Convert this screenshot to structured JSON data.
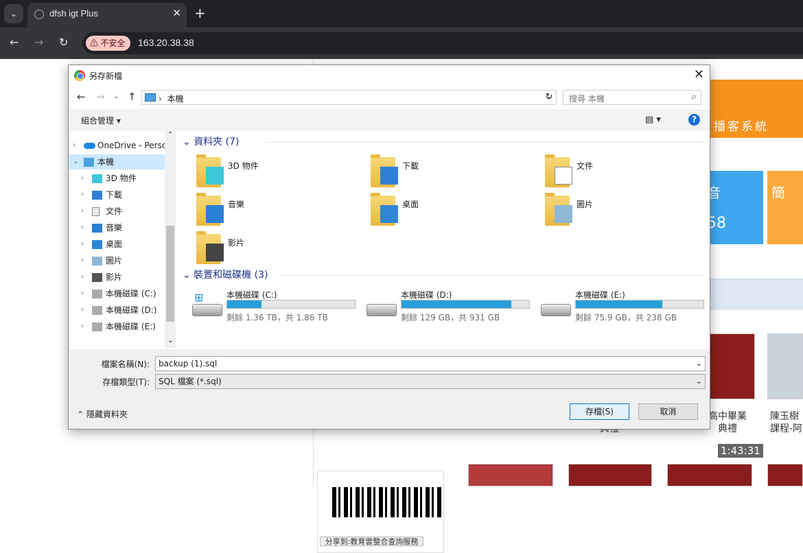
{
  "browser": {
    "tab_title": "dfsh igt Plus",
    "close_glyph": "✕",
    "new_tab_glyph": "+",
    "dropdown_glyph": "⌄",
    "security_label": "不安全",
    "url": "163.20.38.38",
    "nav": {
      "back": "←",
      "forward": "→",
      "reload": "↻"
    }
  },
  "page": {
    "banner_text": "播客系統",
    "blue_card_top": "音",
    "blue_card_number": "58",
    "orange_card_text": "簡",
    "video_duration": "1:43:31",
    "captions": [
      "典禮",
      "高中畢業\n典禮",
      "陳玉樹\n課程-阿"
    ],
    "share_button": "分享到:教育雲整合查詢服務"
  },
  "dialog": {
    "title": "另存新檔",
    "close_glyph": "✕",
    "address": {
      "location": "本機",
      "separator": "›",
      "search_placeholder": "搜尋 本機"
    },
    "commands": {
      "organize": "組合管理 ▾",
      "view_glyph": "▤ ▾",
      "help": "?"
    },
    "nav_pane": {
      "items": [
        {
          "label": "OneDrive - Perso",
          "icon": "onedrive-icon",
          "chev": "›",
          "indent": 0
        },
        {
          "label": "本機",
          "icon": "pc-icon",
          "chev": "⌄",
          "indent": 0,
          "selected": true
        },
        {
          "label": "3D 物件",
          "icon": "3d-objects-icon",
          "chev": "›",
          "indent": 1
        },
        {
          "label": "下載",
          "icon": "downloads-icon",
          "chev": "›",
          "indent": 1
        },
        {
          "label": "文件",
          "icon": "documents-icon",
          "chev": "›",
          "indent": 1
        },
        {
          "label": "音樂",
          "icon": "music-icon",
          "chev": "›",
          "indent": 1
        },
        {
          "label": "桌面",
          "icon": "desktop-icon",
          "chev": "›",
          "indent": 1
        },
        {
          "label": "圖片",
          "icon": "pictures-icon",
          "chev": "›",
          "indent": 1
        },
        {
          "label": "影片",
          "icon": "videos-icon",
          "chev": "›",
          "indent": 1
        },
        {
          "label": "本機磁碟 (C:)",
          "icon": "drive-c-icon",
          "chev": "›",
          "indent": 1
        },
        {
          "label": "本機磁碟 (D:)",
          "icon": "drive-d-icon",
          "chev": "›",
          "indent": 1
        },
        {
          "label": "本機磁碟 (E:)",
          "icon": "drive-e-icon",
          "chev": "›",
          "indent": 1
        }
      ]
    },
    "folders_header": "資料夾 (7)",
    "folders": [
      {
        "name": "3D 物件",
        "icon": "3d-objects-folder-icon"
      },
      {
        "name": "下載",
        "icon": "downloads-folder-icon"
      },
      {
        "name": "文件",
        "icon": "documents-folder-icon"
      },
      {
        "name": "音樂",
        "icon": "music-folder-icon"
      },
      {
        "name": "桌面",
        "icon": "desktop-folder-icon"
      },
      {
        "name": "圖片",
        "icon": "pictures-folder-icon"
      },
      {
        "name": "影片",
        "icon": "videos-folder-icon"
      }
    ],
    "drives_header": "裝置和磁碟機 (3)",
    "drives": [
      {
        "name": "本機磁碟 (C:)",
        "free": "剩餘 1.36 TB，共 1.86 TB",
        "used_fraction": 0.27
      },
      {
        "name": "本機磁碟 (D:)",
        "free": "剩餘 129 GB，共 931 GB",
        "used_fraction": 0.86
      },
      {
        "name": "本機磁碟 (E:)",
        "free": "剩餘 75.9 GB，共 238 GB",
        "used_fraction": 0.68
      }
    ],
    "filename_label": "檔案名稱(N):",
    "filename_value": "backup (1).sql",
    "filetype_label": "存檔類型(T):",
    "filetype_value": "SQL 檔案 (*.sql)",
    "hide_folders": "⌃ 隱藏資料夾",
    "save_button": "存檔(S)",
    "cancel_button": "取消"
  },
  "colors": {
    "accent_blue": "#26a0da",
    "orange": "#f7931e",
    "insecure_chip": "#f9c7c4"
  }
}
